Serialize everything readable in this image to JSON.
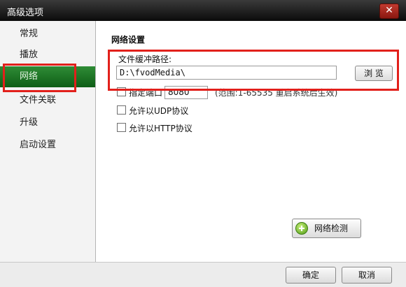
{
  "window": {
    "title": "高级选项",
    "close_glyph": "✕"
  },
  "sidebar": {
    "items": [
      {
        "label": "常规"
      },
      {
        "label": "播放"
      },
      {
        "label": "网络",
        "selected": true
      },
      {
        "label": "文件关联"
      },
      {
        "label": "升级"
      },
      {
        "label": "启动设置"
      }
    ]
  },
  "network": {
    "section_title": "网络设置",
    "cache_path_label": "文件缓冲路径:",
    "cache_path_value": "D:\\fvodMedia\\",
    "browse_label": "浏 览",
    "port_label": "指定端口",
    "port_value": "8080",
    "port_hint": "(范围:1-65535 重启系统后生效)",
    "allow_udp_label": "允许以UDP协议",
    "allow_http_label": "允许以HTTP协议",
    "network_check_label": "网络检测",
    "network_check_icon": "plus-circle-icon"
  },
  "footer": {
    "ok_label": "确定",
    "cancel_label": "取消"
  },
  "colors": {
    "selected_nav": "#1e7a27",
    "highlight_box": "#e2201b",
    "titlebar": "#1a1a1a"
  }
}
